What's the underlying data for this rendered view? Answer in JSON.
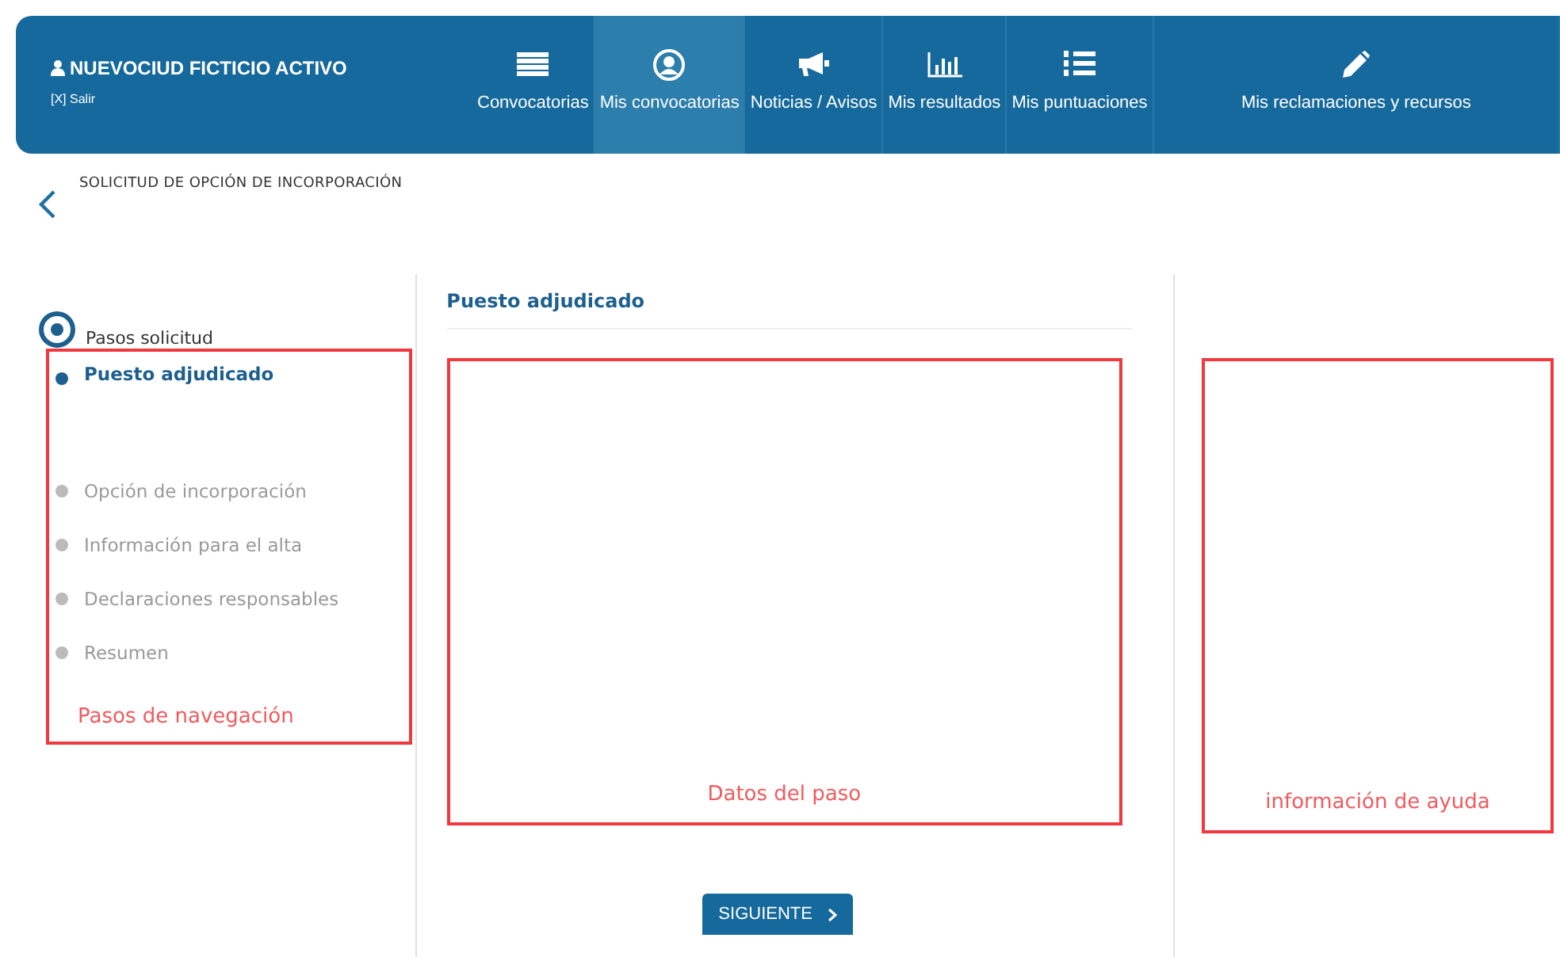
{
  "header": {
    "user": "NUEVOCIUD FICTICIO ACTIVO",
    "logout": "[X] Salir",
    "nav": [
      {
        "label": "Convocatorias",
        "selected": false
      },
      {
        "label": "Mis convocatorias",
        "selected": true
      },
      {
        "label": "Noticias / Avisos",
        "selected": false
      },
      {
        "label": "Mis resultados",
        "selected": false
      },
      {
        "label": "Mis puntuaciones",
        "selected": false
      },
      {
        "label": "Mis reclamaciones y recursos",
        "selected": false
      }
    ]
  },
  "page_title": "SOLICITUD DE OPCIÓN DE INCORPORACIÓN",
  "steps": {
    "heading": "Pasos solicitud",
    "items": [
      {
        "label": "Puesto adjudicado",
        "selected": true
      },
      {
        "label": "Opción de incorporación",
        "selected": false
      },
      {
        "label": "Información para el alta",
        "selected": false
      },
      {
        "label": "Declaraciones responsables",
        "selected": false
      },
      {
        "label": "Resumen",
        "selected": false
      }
    ],
    "annotation": "Pasos de navegación"
  },
  "main": {
    "title": "Puesto adjudicado",
    "annotation": "Datos del paso",
    "next_button": "SIGUIENTE"
  },
  "help": {
    "annotation": "información de ayuda"
  }
}
